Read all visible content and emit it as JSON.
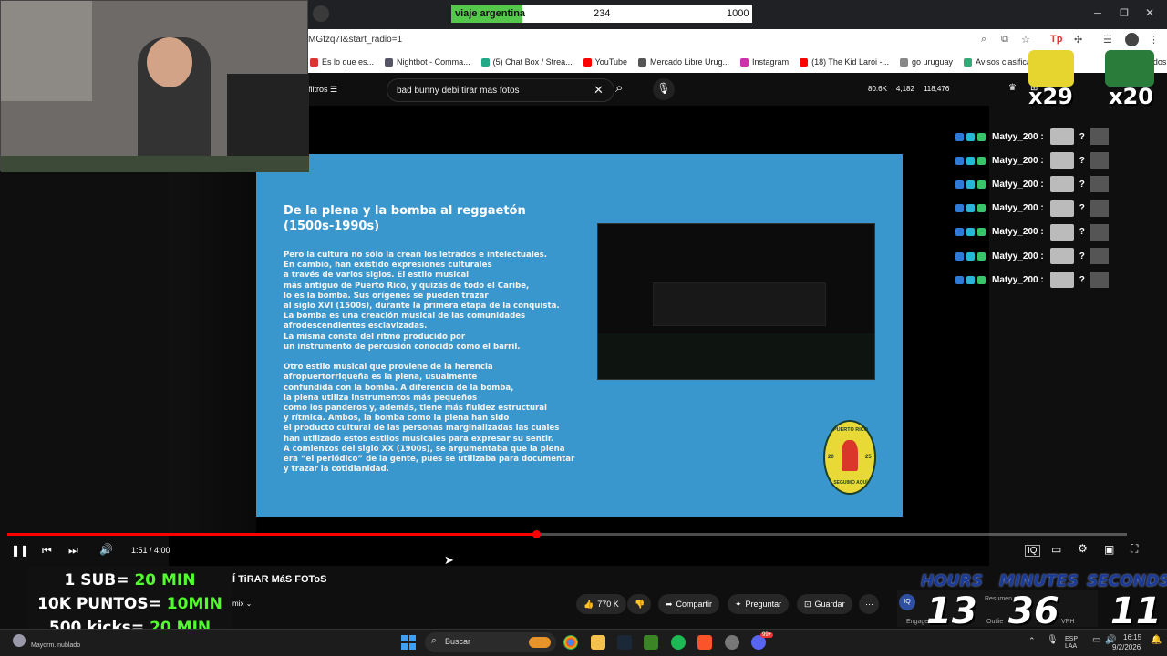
{
  "browser": {
    "url": "MGfzq7I&start_radio=1",
    "bookmarks": [
      "Es lo que es...",
      "Nightbot - Comma...",
      "(5) Chat Box / Strea...",
      "YouTube",
      "Mercado Libre Urug...",
      "Instagram",
      "(18) The Kid Laroi -...",
      "go uruguay",
      "Avisos clasificados g...",
      "Todos"
    ]
  },
  "youtube": {
    "filters_label": "filtros",
    "search_query": "bad bunny debi tirar mas fotos",
    "stats": [
      "80.6K",
      "4,182",
      "118,476"
    ],
    "video_title_partial": "Í TiRAR MáS FOToS",
    "mix_label": "mix",
    "likes": "770 K",
    "share_label": "Compartir",
    "ask_label": "Preguntar",
    "save_label": "Guardar",
    "time": "1:51 / 4:00",
    "progress": 0.472
  },
  "slide": {
    "title": "De la plena y la bomba al reggaetón\n(1500s-1990s)",
    "body": "Pero la cultura no sólo la crean los letrados e intelectuales.\nEn cambio, han existido expresiones culturales\na través de varios siglos. El estilo musical\nmás antiguo de Puerto Rico, y quizás de todo el Caribe,\nlo es la bomba. Sus orígenes se pueden trazar\nal siglo XVI (1500s), durante la primera etapa de la conquista.\nLa bomba es una creación musical de las comunidades\nafrodescendientes esclavizadas.\nLa misma consta del ritmo producido por\nun instrumento de percusión conocido como el barril.\n\nOtro estilo musical que proviene de la herencia\nafropuertorriqueña es la plena, usualmente\nconfundida con la bomba. A diferencia de la bomba,\nla plena utiliza instrumentos más pequeños\ncomo los panderos y, además, tiene más fluidez estructural\ny rítmica. Ambos, la bomba como la plena han sido\nel producto cultural de las personas marginalizadas las cuales\nhan utilizado estos estilos musicales para expresar su sentir.\nA comienzos del siglo XX (1900s), se argumentaba que la plena\nera “el periódico” de la gente, pues se utilizaba para documentar\ny trazar la cotidianidad.",
    "seal_top": "PUERTO RICO",
    "seal_bottom": "SEGUIMO AQUÍ",
    "seal_left": "20",
    "seal_right": "25"
  },
  "chat": {
    "user": "Matyy_200 :",
    "rows": 7,
    "sep": "?"
  },
  "overlay": {
    "goal_label": "viaje argentina",
    "goal_current": "234",
    "goal_target": "1000",
    "multiplier_left": "x29",
    "multiplier_right": "x20",
    "sub_lines": [
      {
        "a": "1 SUB= ",
        "b": "20 MIN"
      },
      {
        "a": "10K PUNTOS= ",
        "b": "10MIN"
      },
      {
        "a": "500 kicks= ",
        "b": "20 MIN"
      }
    ],
    "timer_labels": [
      "HOURS",
      "MINUTES",
      "SECONDS"
    ],
    "timer_values": [
      "13",
      "36",
      "11"
    ]
  },
  "panel_labels": [
    "Resumen",
    "Engage",
    "Outlie",
    "VPH"
  ],
  "taskbar": {
    "weather": "Mayorm. nublado",
    "search": "Buscar",
    "lang": "ESP\nLAA",
    "time": "16:15",
    "date": "9/2/2026",
    "discord_badge": "99+"
  }
}
